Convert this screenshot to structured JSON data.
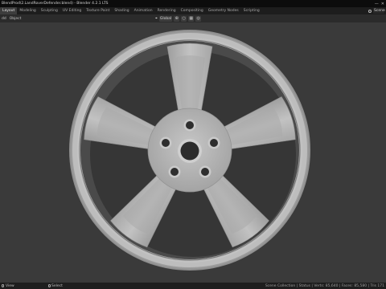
{
  "window": {
    "title": "BlendProd\\2.LandRoverDefender.blend) - Blender 4.2.1 LTS",
    "minimize_icon": "minimize-icon",
    "close_icon": "close-icon"
  },
  "workspace_tabs": [
    {
      "label": "Layout",
      "active": true
    },
    {
      "label": "Modeling",
      "active": false
    },
    {
      "label": "Sculpting",
      "active": false
    },
    {
      "label": "UV Editing",
      "active": false
    },
    {
      "label": "Texture Paint",
      "active": false
    },
    {
      "label": "Shading",
      "active": false
    },
    {
      "label": "Animation",
      "active": false
    },
    {
      "label": "Rendering",
      "active": false
    },
    {
      "label": "Compositing",
      "active": false
    },
    {
      "label": "Geometry Nodes",
      "active": false
    },
    {
      "label": "Scripting",
      "active": false
    }
  ],
  "scene": {
    "label": "Scene"
  },
  "header": {
    "menus": [
      "dd",
      "Object"
    ],
    "orientation_label": "Global"
  },
  "status": {
    "left_label": "View",
    "mid_label": "Select",
    "stats": "Scene Collection | Status | Verts: 85,640 | Faces: 85,580 | Tris 171"
  },
  "colors": {
    "viewport_bg": "#3a3a3a",
    "wheel_face": "#b8b8b8",
    "wheel_shadow": "#6e6e6e"
  }
}
